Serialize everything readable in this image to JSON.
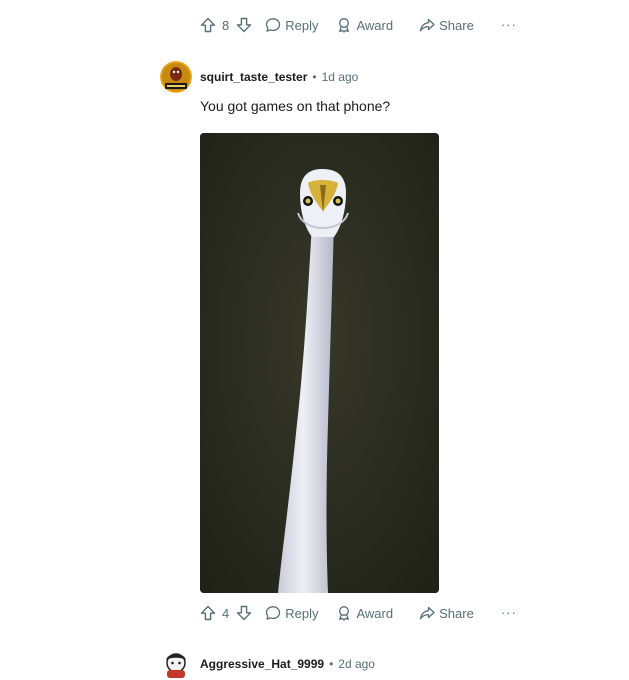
{
  "top_actions": {
    "vote_count": "8",
    "reply_label": "Reply",
    "award_label": "Award",
    "share_label": "Share",
    "more_label": "···"
  },
  "comment": {
    "username": "squirt_taste_tester",
    "separator": "•",
    "time": "1d ago",
    "body": "You got games on that phone?",
    "actions": {
      "vote_count": "4",
      "reply_label": "Reply",
      "award_label": "Award",
      "share_label": "Share",
      "more_label": "···"
    }
  },
  "next_comment": {
    "username": "Aggressive_Hat_9999",
    "separator": "•",
    "time": "2d ago"
  },
  "colors": {
    "meta_text": "#576f76",
    "primary_text": "#1c1c1c",
    "image_bg": "#2a2c1f"
  }
}
